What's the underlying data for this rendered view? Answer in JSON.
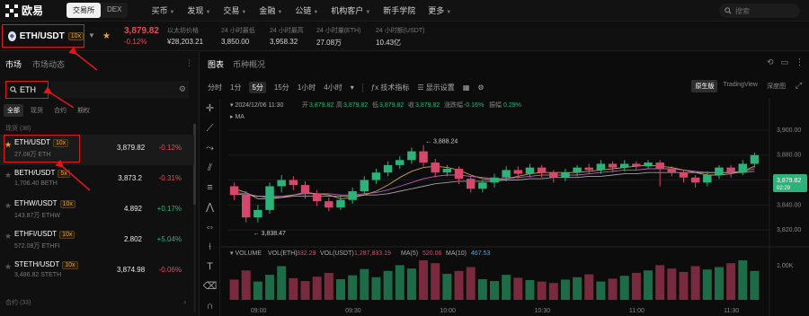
{
  "nav": {
    "logo_text": "欧易",
    "segments": [
      {
        "label": "交易所",
        "active": true
      },
      {
        "label": "DEX",
        "active": false
      }
    ],
    "menu": [
      "买币",
      "发现",
      "交易",
      "金融",
      "公链",
      "机构客户",
      "新手学院",
      "更多"
    ],
    "menu_with_caret": [
      true,
      true,
      true,
      true,
      true,
      true,
      false,
      true
    ],
    "search_placeholder": "搜索"
  },
  "ticker": {
    "pair": "ETH/USDT",
    "leverage": "10x",
    "price": "3,879.82",
    "change": "-0.12%",
    "stats": [
      {
        "label": "以太坊价格",
        "value": "¥28,203.21"
      },
      {
        "label": "24 小时最低",
        "value": "3,850.00"
      },
      {
        "label": "24 小时最高",
        "value": "3,958.32"
      },
      {
        "label": "24 小时量(ETH)",
        "value": "27.08万"
      },
      {
        "label": "24 小时额(USDT)",
        "value": "10.43亿"
      }
    ]
  },
  "left": {
    "tabs": [
      "市场",
      "市场动态"
    ],
    "search_value": "ETH",
    "categories": [
      "全部",
      "现货",
      "合约",
      "期权"
    ],
    "section_label": "现货 (38)",
    "rows": [
      {
        "name": "ETH/USDT",
        "lev": "10x",
        "vol": "27.08万 ETH",
        "price": "3,879.82",
        "change": "-0.12%",
        "dir": "neg",
        "star": true,
        "selected": true
      },
      {
        "name": "BETH/USDT",
        "lev": "5x",
        "vol": "1,706.40 BETH",
        "price": "3,873.2",
        "change": "-0.31%",
        "dir": "neg",
        "star": false,
        "selected": false
      },
      {
        "name": "ETHW/USDT",
        "lev": "10x",
        "vol": "143.87万 ETHW",
        "price": "4.892",
        "change": "+0.17%",
        "dir": "pos",
        "star": false,
        "selected": false
      },
      {
        "name": "ETHFI/USDT",
        "lev": "10x",
        "vol": "572.08万 ETHFI",
        "price": "2.802",
        "change": "+5.04%",
        "dir": "pos",
        "star": false,
        "selected": false
      },
      {
        "name": "STETH/USDT",
        "lev": "10x",
        "vol": "3,486.82 STETH",
        "price": "3,874.98",
        "change": "-0.06%",
        "dir": "neg",
        "star": false,
        "selected": false
      }
    ],
    "bottom_label": "合约 (33)"
  },
  "right": {
    "tabs": [
      "图表",
      "币种概况"
    ],
    "intervals": [
      "分时",
      "1分",
      "5分",
      "15分",
      "1小时",
      "4小时"
    ],
    "active_interval": "5分",
    "tool_labels": [
      "技术指标",
      "显示设置"
    ],
    "views": [
      "原生版",
      "TradingView",
      "深度图"
    ],
    "active_view": "原生版",
    "candle_info": {
      "time": "2024/12/06 11:30",
      "open": "3,879.82",
      "high": "3,879.82",
      "low": "3,879.82",
      "close": "3,879.82",
      "chg": "-0.16%",
      "amp": "0.29%",
      "labels": {
        "open": "开",
        "high": "高",
        "low": "低",
        "close": "收",
        "chg": "涨跌幅",
        "amp": "振幅"
      },
      "ma_label": "MA"
    },
    "volume_info": {
      "label": "VOLUME",
      "v1": "VOL(ETH)",
      "v1_value": "332.29",
      "v2": "VOL(USDT)",
      "v2_value": "1,287,833.19",
      "ma5": "MA(5)",
      "ma5_value": "520.06",
      "ma10": "MA(10)",
      "ma10_value": "467.53"
    },
    "y_ticks": [
      "3,900.00",
      "3,880.00",
      "3,860.00",
      "3,840.00",
      "3,820.00"
    ],
    "vol_tick": "1.00K",
    "x_ticks": [
      "09:00",
      "09:30",
      "10:00",
      "10:30",
      "11:00",
      "11:30"
    ],
    "price_tag": "3,879.82",
    "price_tag_time": "02:29",
    "high_marker": "3,888.24",
    "low_marker": "3,838.47"
  },
  "chart_data": {
    "type": "candlestick",
    "ylim": [
      3810,
      3905
    ],
    "up_color": "#2cb37a",
    "down_color": "#d6476c",
    "candles": [
      {
        "o": 3855,
        "c": 3848,
        "h": 3858,
        "l": 3844
      },
      {
        "o": 3848,
        "c": 3830,
        "h": 3851,
        "l": 3826
      },
      {
        "o": 3830,
        "c": 3836,
        "h": 3840,
        "l": 3826
      },
      {
        "o": 3836,
        "c": 3855,
        "h": 3858,
        "l": 3833
      },
      {
        "o": 3855,
        "c": 3860,
        "h": 3864,
        "l": 3850
      },
      {
        "o": 3860,
        "c": 3856,
        "h": 3863,
        "l": 3852
      },
      {
        "o": 3856,
        "c": 3849,
        "h": 3859,
        "l": 3845
      },
      {
        "o": 3849,
        "c": 3843,
        "h": 3852,
        "l": 3839
      },
      {
        "o": 3843,
        "c": 3838,
        "h": 3846,
        "l": 3835
      },
      {
        "o": 3838,
        "c": 3844,
        "h": 3848,
        "l": 3836
      },
      {
        "o": 3844,
        "c": 3851,
        "h": 3854,
        "l": 3841
      },
      {
        "o": 3851,
        "c": 3860,
        "h": 3863,
        "l": 3849
      },
      {
        "o": 3860,
        "c": 3866,
        "h": 3869,
        "l": 3857
      },
      {
        "o": 3866,
        "c": 3872,
        "h": 3875,
        "l": 3863
      },
      {
        "o": 3872,
        "c": 3876,
        "h": 3879,
        "l": 3869
      },
      {
        "o": 3876,
        "c": 3883,
        "h": 3886,
        "l": 3873
      },
      {
        "o": 3883,
        "c": 3874,
        "h": 3888,
        "l": 3871
      },
      {
        "o": 3874,
        "c": 3866,
        "h": 3877,
        "l": 3862
      },
      {
        "o": 3866,
        "c": 3869,
        "h": 3872,
        "l": 3863
      },
      {
        "o": 3869,
        "c": 3861,
        "h": 3871,
        "l": 3857
      },
      {
        "o": 3861,
        "c": 3853,
        "h": 3863,
        "l": 3850
      },
      {
        "o": 3853,
        "c": 3858,
        "h": 3860,
        "l": 3850
      },
      {
        "o": 3858,
        "c": 3862,
        "h": 3865,
        "l": 3854
      },
      {
        "o": 3862,
        "c": 3868,
        "h": 3871,
        "l": 3859
      },
      {
        "o": 3868,
        "c": 3865,
        "h": 3871,
        "l": 3861
      },
      {
        "o": 3865,
        "c": 3870,
        "h": 3873,
        "l": 3862
      },
      {
        "o": 3870,
        "c": 3866,
        "h": 3872,
        "l": 3862
      },
      {
        "o": 3866,
        "c": 3862,
        "h": 3868,
        "l": 3858
      },
      {
        "o": 3862,
        "c": 3866,
        "h": 3869,
        "l": 3859
      },
      {
        "o": 3866,
        "c": 3870,
        "h": 3872,
        "l": 3863
      },
      {
        "o": 3870,
        "c": 3868,
        "h": 3873,
        "l": 3865
      },
      {
        "o": 3868,
        "c": 3873,
        "h": 3876,
        "l": 3865
      },
      {
        "o": 3873,
        "c": 3870,
        "h": 3875,
        "l": 3866
      },
      {
        "o": 3870,
        "c": 3873,
        "h": 3876,
        "l": 3867
      },
      {
        "o": 3873,
        "c": 3871,
        "h": 3875,
        "l": 3868
      },
      {
        "o": 3871,
        "c": 3874,
        "h": 3876,
        "l": 3869
      },
      {
        "o": 3874,
        "c": 3869,
        "h": 3876,
        "l": 3855
      },
      {
        "o": 3869,
        "c": 3866,
        "h": 3871,
        "l": 3863
      },
      {
        "o": 3866,
        "c": 3862,
        "h": 3868,
        "l": 3858
      },
      {
        "o": 3862,
        "c": 3858,
        "h": 3864,
        "l": 3854
      },
      {
        "o": 3858,
        "c": 3864,
        "h": 3867,
        "l": 3855
      },
      {
        "o": 3864,
        "c": 3870,
        "h": 3872,
        "l": 3861
      },
      {
        "o": 3870,
        "c": 3866,
        "h": 3872,
        "l": 3862
      },
      {
        "o": 3866,
        "c": 3873,
        "h": 3876,
        "l": 3864
      },
      {
        "o": 3873,
        "c": 3880,
        "h": 3882,
        "l": 3870
      }
    ],
    "volumes": [
      420,
      610,
      380,
      520,
      700,
      450,
      390,
      480,
      560,
      430,
      510,
      640,
      470,
      600,
      720,
      650,
      820,
      760,
      540,
      600,
      680,
      430,
      390,
      520,
      460,
      410,
      380,
      350,
      420,
      470,
      530,
      380,
      440,
      500,
      560,
      610,
      720,
      650,
      580,
      700,
      630,
      680,
      760,
      820,
      600
    ],
    "ma_lines": [
      {
        "name": "MA",
        "color": "#e6c15a",
        "values": [
          3853,
          3850,
          3845,
          3845,
          3846,
          3848,
          3850,
          3849,
          3848,
          3845,
          3846,
          3848,
          3851,
          3856,
          3862,
          3867,
          3870,
          3871,
          3870,
          3868,
          3864,
          3861,
          3860,
          3861,
          3863,
          3865,
          3866,
          3866,
          3866,
          3866,
          3867,
          3868,
          3869,
          3870,
          3871,
          3872,
          3871,
          3870,
          3868,
          3866,
          3864,
          3864,
          3865,
          3867,
          3871
        ]
      },
      {
        "name": "MA",
        "color": "#d56fd6",
        "values": [
          3850,
          3849,
          3847,
          3847,
          3847,
          3848,
          3849,
          3849,
          3849,
          3848,
          3848,
          3849,
          3850,
          3852,
          3855,
          3858,
          3861,
          3863,
          3864,
          3864,
          3863,
          3862,
          3861,
          3861,
          3862,
          3863,
          3864,
          3864,
          3864,
          3864,
          3865,
          3866,
          3867,
          3868,
          3868,
          3869,
          3869,
          3869,
          3868,
          3867,
          3866,
          3866,
          3866,
          3867,
          3869
        ]
      },
      {
        "name": "MA",
        "color": "#bbbbbb",
        "values": [
          3849,
          3848,
          3847,
          3846,
          3846,
          3847,
          3847,
          3847,
          3847,
          3847,
          3847,
          3848,
          3848,
          3849,
          3851,
          3853,
          3855,
          3857,
          3858,
          3859,
          3859,
          3859,
          3859,
          3860,
          3860,
          3861,
          3861,
          3862,
          3862,
          3862,
          3863,
          3863,
          3864,
          3865,
          3865,
          3866,
          3866,
          3866,
          3866,
          3866,
          3866,
          3866,
          3866,
          3866,
          3867
        ]
      }
    ]
  }
}
